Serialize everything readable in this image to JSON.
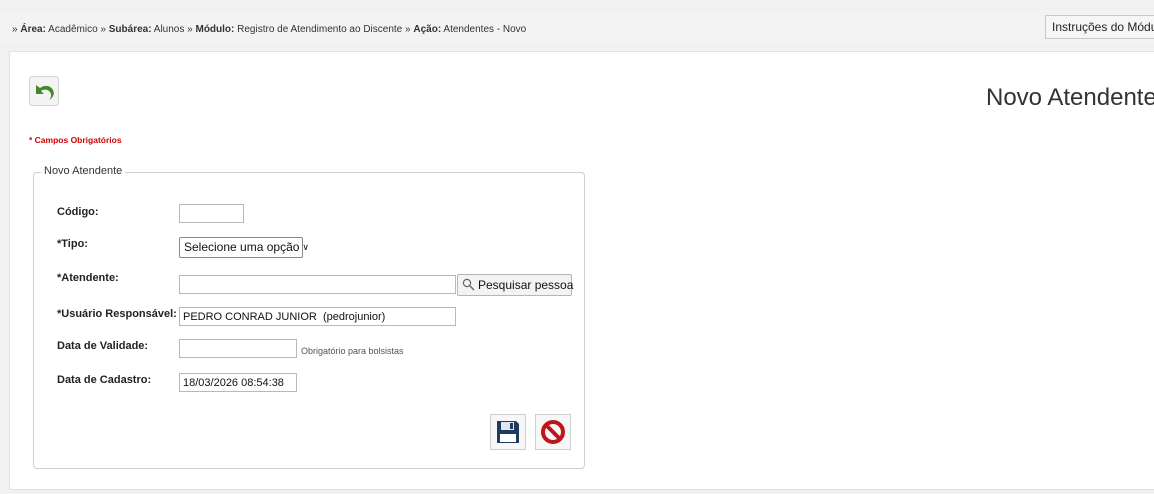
{
  "breadcrumb": {
    "prefix": "»",
    "area_label": "Área:",
    "area_value": "Acadêmico",
    "sep1": "»",
    "subarea_label": "Subárea:",
    "subarea_value": "Alunos",
    "sep2": "»",
    "modulo_label": "Módulo:",
    "modulo_value": "Registro de Atendimento ao Discente",
    "sep3": "»",
    "acao_label": "Ação:",
    "acao_value": "Atendentes - Novo"
  },
  "header": {
    "instructions_button": "Instruções do Módulo",
    "page_title": "Novo Atendente"
  },
  "form": {
    "required_note": "* Campos Obrigatórios",
    "legend": "Novo Atendente",
    "fields": {
      "codigo": {
        "label": "Código:",
        "value": ""
      },
      "tipo": {
        "label": "*Tipo:",
        "selected": "Selecione uma opção"
      },
      "atendente": {
        "label": "*Atendente:",
        "value": "",
        "search_button": "Pesquisar pessoa"
      },
      "usuario": {
        "label": "*Usuário Responsável:",
        "value": "PEDRO CONRAD JUNIOR  (pedrojunior)"
      },
      "validade": {
        "label": "Data de Validade:",
        "value": "",
        "hint": "Obrigatório para bolsistas"
      },
      "cadastro": {
        "label": "Data de Cadastro:",
        "value": "18/03/2026 08:54:38"
      }
    }
  },
  "icons": {
    "back": "back-arrow-icon",
    "search": "magnifier-icon",
    "save": "floppy-disk-icon",
    "cancel": "prohibited-icon"
  },
  "colors": {
    "required": "#d40000",
    "back_green": "#3e8a2c",
    "cancel_red": "#c0141b",
    "save_navy": "#1f3a5f"
  }
}
